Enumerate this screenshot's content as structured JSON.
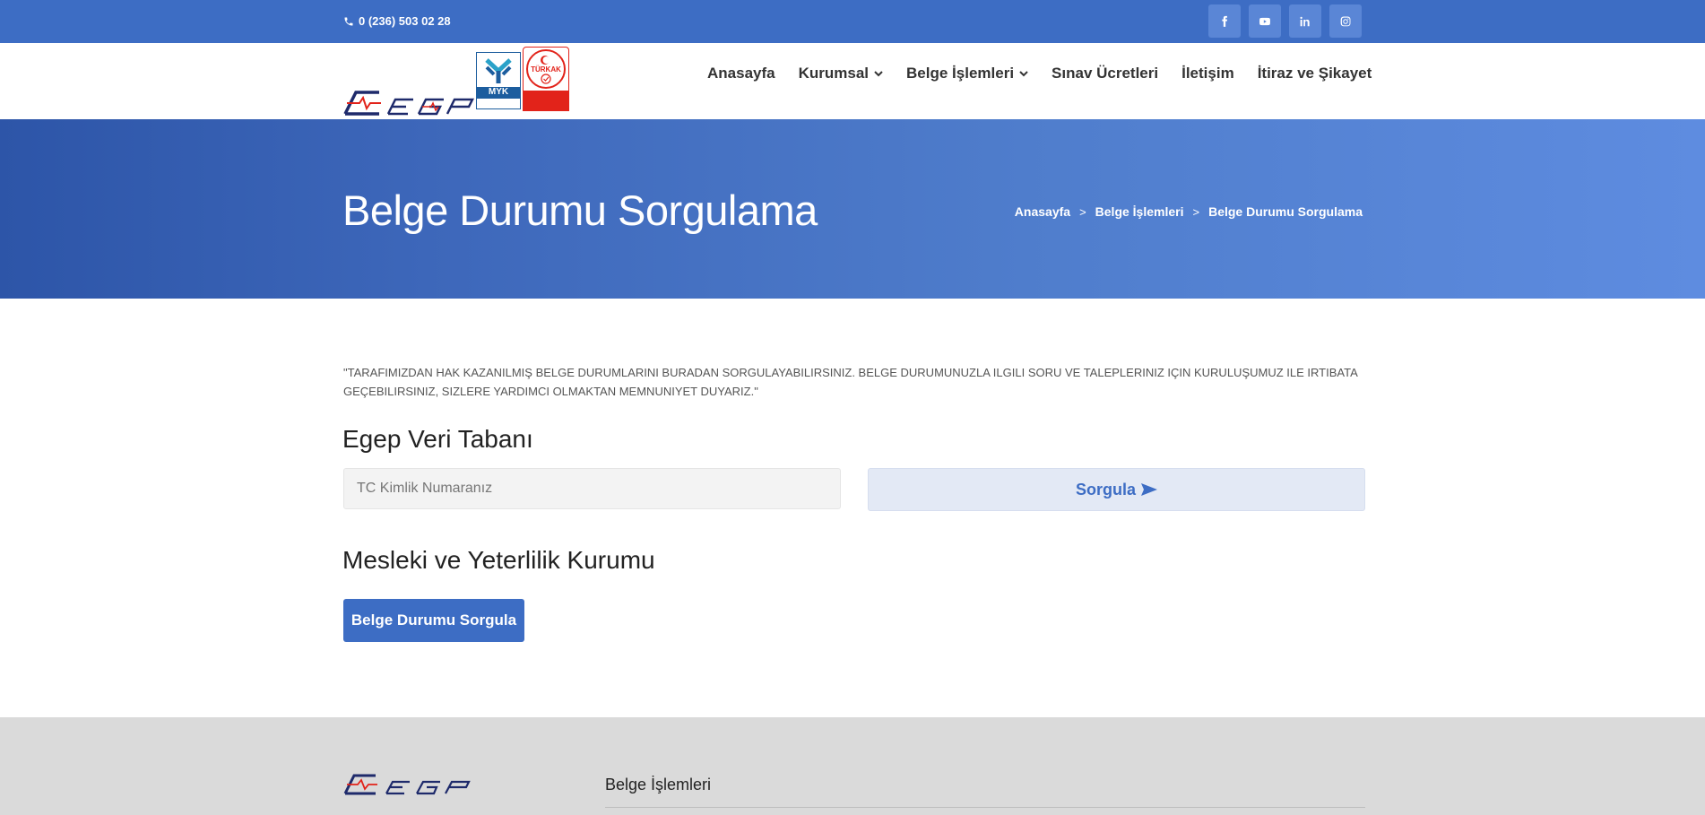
{
  "topbar": {
    "phone": "0 (236) 503 02 28",
    "socials": [
      {
        "icon": "facebook-icon",
        "glyph": "f"
      },
      {
        "icon": "youtube-icon",
        "glyph": "▶"
      },
      {
        "icon": "linkedin-icon",
        "glyph": "in"
      },
      {
        "icon": "instagram-icon",
        "glyph": "◎"
      }
    ]
  },
  "header": {
    "logo_text": "EGEP",
    "badge_myk": "MYK",
    "badge_turkak": "TÜRKAK",
    "nav": [
      {
        "label": "Anasayfa",
        "dropdown": false
      },
      {
        "label": "Kurumsal",
        "dropdown": true
      },
      {
        "label": "Belge İşlemleri",
        "dropdown": true
      },
      {
        "label": "Sınav Ücretleri",
        "dropdown": false
      },
      {
        "label": "İletişim",
        "dropdown": false
      },
      {
        "label": "İtiraz ve Şikayet",
        "dropdown": false
      }
    ]
  },
  "banner": {
    "title": "Belge Durumu Sorgulama",
    "breadcrumb": [
      "Anasayfa",
      "Belge İşlemleri",
      "Belge Durumu Sorgulama"
    ],
    "separator": ">"
  },
  "main": {
    "intro": "\"Tarafımızdan hak kazanılmış belge durumlarını buradan sorgulayabilirsiniz. Belge durumunuzla ilgili soru ve talepleriniz için kuruluşumuz ile irtibata geçebilirsiniz, sizlere yardımcı olmaktan memnuniyet duyarız.\"",
    "section1_title": "Egep Veri Tabanı",
    "tc_placeholder": "TC Kimlik Numaranız",
    "sorgula_label": "Sorgula",
    "section2_title": "Mesleki ve Yeterlilik Kurumu",
    "belge_button": "Belge Durumu Sorgula"
  },
  "footer": {
    "heading": "Belge İşlemleri"
  },
  "colors": {
    "primary": "#3d6dc4",
    "brand_red": "#e2231a",
    "logo_navy": "#1e2a6b"
  }
}
